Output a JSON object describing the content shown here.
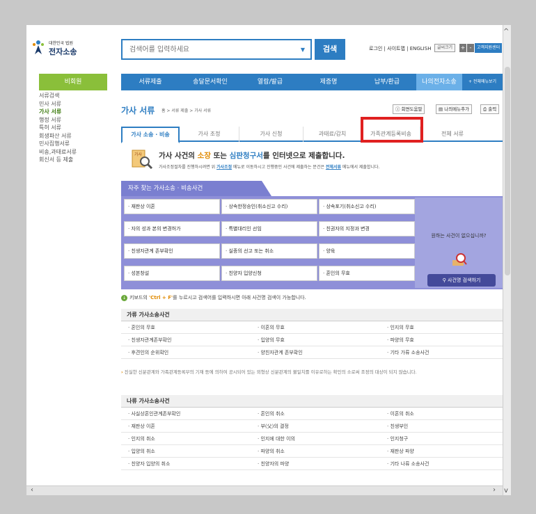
{
  "header": {
    "logo_small": "대한민국 법원",
    "logo_big": "전자소송",
    "search_placeholder": "검색어를 입력하세요",
    "search_button": "검색",
    "top_links": "로그인 | 사이트맵 | ENGLISH",
    "font_size_label": "글씨크기",
    "plus": "+",
    "minus": "-",
    "help_center": "고객지원센터"
  },
  "sidebar": {
    "title": "비회원",
    "items": [
      "서류검색",
      "민사 서류",
      "가사 서류",
      "행정 서류",
      "특허 서류",
      "회생파산 서류",
      "민사집행서류",
      "비송,과태료서류",
      "회신서 등 제출"
    ],
    "active_index": 2
  },
  "nav": {
    "items": [
      "서류제출",
      "송달문서확인",
      "열람/발급",
      "제증명",
      "납부/환급",
      "나의전자소송",
      "+ 전체메뉴보기"
    ],
    "active_index": 5
  },
  "page": {
    "title": "가사 서류",
    "breadcrumb": "홈 > 서류 제출 > 가사 서류",
    "tools": [
      "회면도움말",
      "나의메뉴추가",
      "출력"
    ]
  },
  "tabs": {
    "items": [
      "가사 소송 · 비송",
      "가사 조정",
      "가사 신청",
      "과태료/감치",
      "가족관계등록비송",
      "전체 서류"
    ],
    "active_index": 0,
    "highlighted_index": 4
  },
  "intro": {
    "title_pre": "가사 사건의 ",
    "title_a": "소장",
    "title_mid": " 또는 ",
    "title_b": "심판청구서",
    "title_post": "를 인터넷으로 제출합니다.",
    "desc_pre": "가사조정절차를 진행하시려면 위 ",
    "desc_link1": "가사조정",
    "desc_mid": " 메뉴로 이동하시고 진행중인 사건에 제출하는 문건은 ",
    "desc_link2": "전체서류",
    "desc_post": " 메뉴에서 제출합니다."
  },
  "frequent": {
    "title": "자주 찾는 가사소송 · 비송사건",
    "cells": [
      "· 재판상 이혼",
      "· 상속한정승인(취소신고 수리)",
      "· 상속포기(취소신고 수리)",
      "· 자의 성과 본의 변경허가",
      "· 특별대리인 선임",
      "· 친권자의 지정과 변경",
      "· 친생자관계 존부확인",
      "· 실종의 선고 또는 취소",
      "· 양육",
      "· 성본창설",
      "· 친양자 입양신청",
      "· 혼인의 무효"
    ],
    "question": "원하는 사건이 없으십니까?",
    "search_button": "사건명 검색하기"
  },
  "hint": {
    "pre": "키보드의 ",
    "key": "'Ctrl + F'",
    "post": "를 누르시고 검색어를 입력하시면 아래 사건명 검색이 가능합니다."
  },
  "section_ga": {
    "title": "가류 가사소송사건",
    "rows": [
      [
        "· 혼인의 무효",
        "· 이혼의 무효",
        "· 인지의 무효"
      ],
      [
        "· 친생자관계존부확인",
        "· 입양의 무효",
        "· 파양의 무효"
      ],
      [
        "· 후견인의 순위확인",
        "· 양친자관계 존부확인",
        "· 기타 가류 소송사건"
      ]
    ],
    "note_mark": "›",
    "note": "진실한 신분관계와 가족관계등록부의 기재 등에 의하여 공시되어 있는 외형상 신분관계의 불일치를 이유로하는 확인의 소로써 조정의 대상이 되지 않습니다."
  },
  "section_na": {
    "title": "나류 가사소송사건",
    "rows": [
      [
        "· 사실상혼인관계존부확인",
        "· 혼인의 취소",
        "· 이혼의 취소"
      ],
      [
        "· 재판상 이혼",
        "· 부(父)의 결정",
        "· 친생부인"
      ],
      [
        "· 인지의 취소",
        "· 인지에 대한 이의",
        "· 인지청구"
      ],
      [
        "· 입양의 취소",
        "· 파양의 취소",
        "· 재판상 파양"
      ],
      [
        "· 친양자 입양의 취소",
        "· 친양자의 파양",
        "· 기타 나류 소송사건"
      ]
    ]
  },
  "colors": {
    "brand_blue": "#2d7dc2",
    "green": "#8abf3a",
    "purple": "#8e8fd8",
    "highlight_red": "#e02020"
  }
}
